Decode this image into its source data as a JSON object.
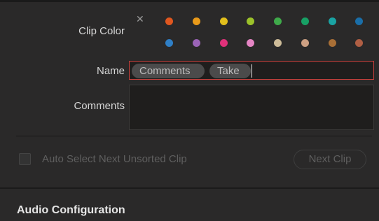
{
  "clip_color": {
    "label": "Clip Color",
    "clear_icon": "close-icon",
    "swatches_row1": [
      "#e0571f",
      "#e99a1a",
      "#e2bf1c",
      "#9cc22a",
      "#3faa4a",
      "#17a065",
      "#1aa3a3",
      "#1a6ea8"
    ],
    "swatches_row2": [
      "#2f7fc6",
      "#9a63b6",
      "#e0317a",
      "#e585c4",
      "#cdbb98",
      "#cda083",
      "#a96f36",
      "#b05f44"
    ]
  },
  "name": {
    "label": "Name",
    "tokens": [
      "Comments",
      "Take"
    ]
  },
  "comments": {
    "label": "Comments",
    "value": ""
  },
  "auto_select": {
    "label": "Auto Select Next Unsorted Clip",
    "checked": false
  },
  "next_clip_label": "Next Clip",
  "audio_configuration_title": "Audio Configuration"
}
